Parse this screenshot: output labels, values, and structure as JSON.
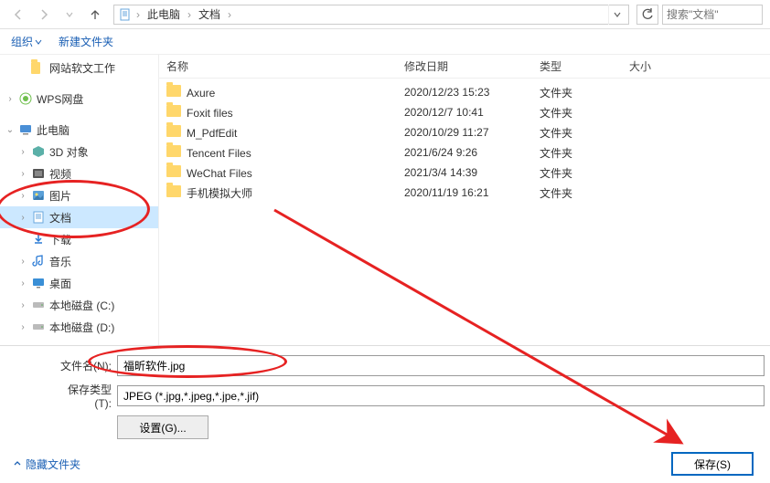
{
  "breadcrumb": {
    "parts": [
      "此电脑",
      "文档"
    ]
  },
  "search": {
    "placeholder": "搜索\"文档\""
  },
  "toolbar": {
    "organize": "组织",
    "new_folder": "新建文件夹"
  },
  "sidebar": {
    "items": [
      {
        "label": "网站软文工作",
        "icon": "folder",
        "indent": 1,
        "chev": ""
      },
      {
        "label": "WPS网盘",
        "icon": "wps",
        "indent": 0,
        "chev": ">"
      },
      {
        "label": "此电脑",
        "icon": "pc",
        "indent": 0,
        "chev": "v"
      },
      {
        "label": "3D 对象",
        "icon": "3d",
        "indent": 1,
        "chev": ">"
      },
      {
        "label": "视频",
        "icon": "video",
        "indent": 1,
        "chev": ">"
      },
      {
        "label": "图片",
        "icon": "pic",
        "indent": 1,
        "chev": ">"
      },
      {
        "label": "文档",
        "icon": "doc",
        "indent": 1,
        "chev": ">",
        "selected": true
      },
      {
        "label": "下载",
        "icon": "dl",
        "indent": 1,
        "chev": ""
      },
      {
        "label": "音乐",
        "icon": "music",
        "indent": 1,
        "chev": ">"
      },
      {
        "label": "桌面",
        "icon": "desk",
        "indent": 1,
        "chev": ">"
      },
      {
        "label": "本地磁盘 (C:)",
        "icon": "disk",
        "indent": 1,
        "chev": ">"
      },
      {
        "label": "本地磁盘 (D:)",
        "icon": "disk",
        "indent": 1,
        "chev": ">"
      }
    ]
  },
  "columns": {
    "name": "名称",
    "date": "修改日期",
    "type": "类型",
    "size": "大小"
  },
  "files": [
    {
      "name": "Axure",
      "date": "2020/12/23 15:23",
      "type": "文件夹"
    },
    {
      "name": "Foxit files",
      "date": "2020/12/7 10:41",
      "type": "文件夹"
    },
    {
      "name": "M_PdfEdit",
      "date": "2020/10/29 11:27",
      "type": "文件夹"
    },
    {
      "name": "Tencent Files",
      "date": "2021/6/24 9:26",
      "type": "文件夹"
    },
    {
      "name": "WeChat Files",
      "date": "2021/3/4 14:39",
      "type": "文件夹"
    },
    {
      "name": "手机模拟大师",
      "date": "2020/11/19 16:21",
      "type": "文件夹"
    }
  ],
  "form": {
    "filename_label": "文件名(N):",
    "filename_value": "福昕软件.jpg",
    "type_label": "保存类型(T):",
    "type_value": "JPEG (*.jpg,*.jpeg,*.jpe,*.jif)",
    "settings": "设置(G)...",
    "hide_folders": "隐藏文件夹",
    "save": "保存(S)"
  }
}
